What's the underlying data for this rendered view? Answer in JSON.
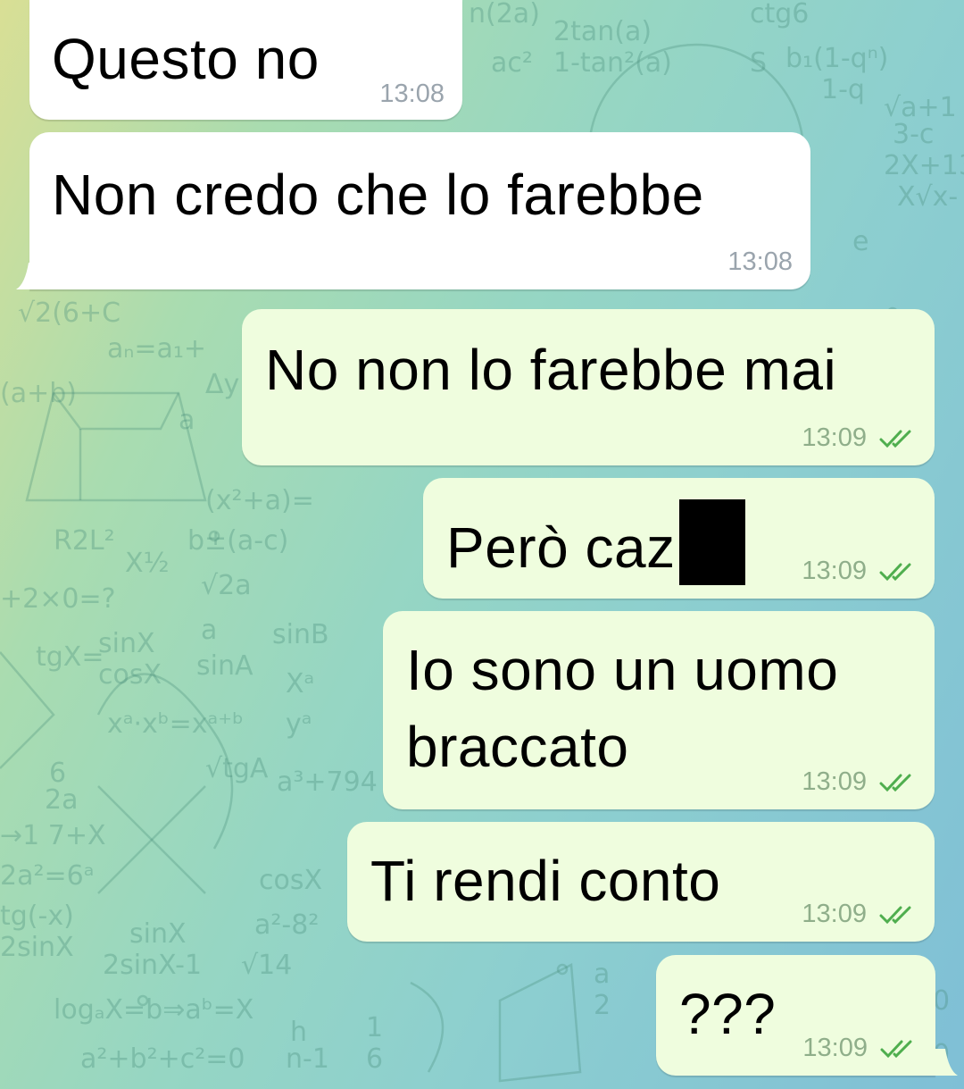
{
  "messages": [
    {
      "text": "Questo no",
      "time": "13:08",
      "direction": "incoming"
    },
    {
      "text": "Non credo che lo farebbe",
      "time": "13:08",
      "direction": "incoming"
    },
    {
      "text": "No non lo farebbe mai",
      "time": "13:09",
      "direction": "outgoing",
      "status": "read"
    },
    {
      "text": "Però caz",
      "time": "13:09",
      "direction": "outgoing",
      "status": "read",
      "redacted": true
    },
    {
      "text_line1": "Io sono un uomo",
      "text_line2": "braccato",
      "time": "13:09",
      "direction": "outgoing",
      "status": "read"
    },
    {
      "text": "Ti rendi conto",
      "time": "13:09",
      "direction": "outgoing",
      "status": "read"
    },
    {
      "text": "???",
      "time": "13:09",
      "direction": "outgoing",
      "status": "read"
    }
  ],
  "colors": {
    "incoming_bubble": "#ffffff",
    "outgoing_bubble": "#effdde",
    "read_check": "#4fae4e",
    "wallpaper_from": "#d9df95",
    "wallpaper_to": "#7fbfd6"
  },
  "icons": {
    "read_receipt": "double-check-icon"
  }
}
